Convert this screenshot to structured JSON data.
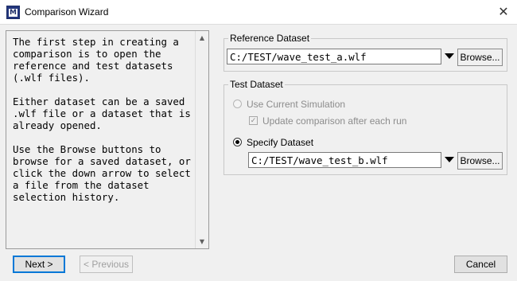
{
  "window": {
    "title": "Comparison Wizard",
    "icon_letter": "M",
    "close_glyph": "✕"
  },
  "help_panel": {
    "lines": [
      "The first step in creating a",
      "comparison is to open the",
      "reference and test datasets",
      "(.wlf files).",
      "",
      "Either dataset can be a saved",
      ".wlf file or a dataset that is",
      "already opened.",
      "",
      "Use the Browse buttons to",
      "browse for a saved dataset, or",
      "click the down arrow to select",
      "a file from the dataset",
      "selection history."
    ]
  },
  "reference": {
    "group_title": "Reference Dataset",
    "path": "C:/TEST/wave_test_a.wlf",
    "browse_label": "Browse..."
  },
  "test": {
    "group_title": "Test Dataset",
    "use_current_label": "Use Current Simulation",
    "update_label": "Update comparison after each run",
    "specify_label": "Specify Dataset",
    "path": "C:/TEST/wave_test_b.wlf",
    "browse_label": "Browse..."
  },
  "footer": {
    "next_label": "Next >",
    "previous_label": "< Previous",
    "cancel_label": "Cancel"
  }
}
